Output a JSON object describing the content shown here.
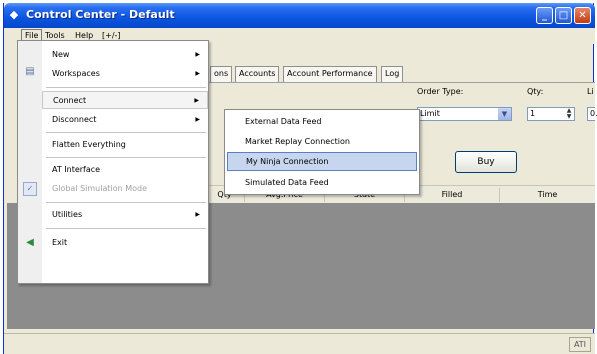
{
  "window": {
    "title": "Control Center - Default",
    "controls": {
      "minimize": "_",
      "maximize": "□",
      "close": "✕"
    }
  },
  "menubar": {
    "items": [
      {
        "label": "File"
      },
      {
        "label": "Tools"
      },
      {
        "label": "Help"
      },
      {
        "label": "[+/-]"
      }
    ]
  },
  "tabs": [
    {
      "label": "ons"
    },
    {
      "label": "Accounts"
    },
    {
      "label": "Account Performance"
    },
    {
      "label": "Log"
    }
  ],
  "order_panel": {
    "order_type_label": "Order Type:",
    "order_type_value": "Limit",
    "qty_label": "Qty:",
    "qty_value": "1",
    "limit_label": "Li",
    "limit_value": "0.",
    "buy_label": "Buy"
  },
  "grid": {
    "columns": [
      "Qty",
      "Avg.Price",
      "State",
      "Filled",
      "Time"
    ]
  },
  "file_menu": {
    "items": [
      {
        "label": "New",
        "submenu": true
      },
      {
        "label": "Workspaces",
        "submenu": true
      },
      {
        "label": "Connect",
        "submenu": true,
        "highlighted": true
      },
      {
        "label": "Disconnect",
        "submenu": true
      },
      {
        "label": "Flatten Everything"
      },
      {
        "label": "AT Interface"
      },
      {
        "label": "Global Simulation Mode",
        "disabled": true
      },
      {
        "label": "Utilities",
        "submenu": true
      },
      {
        "label": "Exit"
      }
    ]
  },
  "connect_submenu": {
    "items": [
      {
        "label": "External Data Feed"
      },
      {
        "label": "Market Replay Connection"
      },
      {
        "label": "My Ninja Connection",
        "highlighted": true
      },
      {
        "label": "Simulated Data Feed"
      }
    ]
  },
  "statusbar": {
    "indicator": "ATI"
  },
  "colors": {
    "title_bar": "#0b55e0",
    "highlight": "#c6d6ef",
    "grid_background": "#8c8c8c"
  }
}
